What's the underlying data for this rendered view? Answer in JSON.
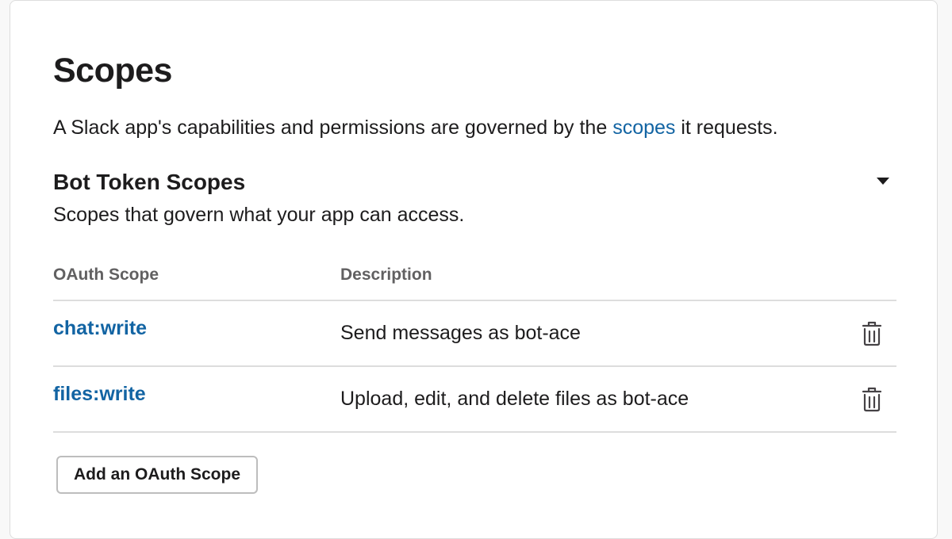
{
  "header": {
    "title": "Scopes"
  },
  "intro": {
    "before": "A Slack app's capabilities and permissions are governed by the ",
    "link": "scopes",
    "after": " it requests."
  },
  "bot_token_scopes": {
    "title": "Bot Token Scopes",
    "subtitle": "Scopes that govern what your app can access.",
    "toggle_icon": "caret-down-icon",
    "table": {
      "columns": [
        "OAuth Scope",
        "Description"
      ],
      "rows": [
        {
          "scope": "chat:write",
          "description": "Send messages as bot-ace",
          "action_icon": "trash-icon"
        },
        {
          "scope": "files:write",
          "description": "Upload, edit, and delete files as bot-ace",
          "action_icon": "trash-icon"
        }
      ]
    },
    "add_button_label": "Add an OAuth Scope"
  },
  "colors": {
    "link": "#1264a3",
    "text": "#1d1c1d",
    "muted": "#616061",
    "divider": "#dddddd"
  }
}
